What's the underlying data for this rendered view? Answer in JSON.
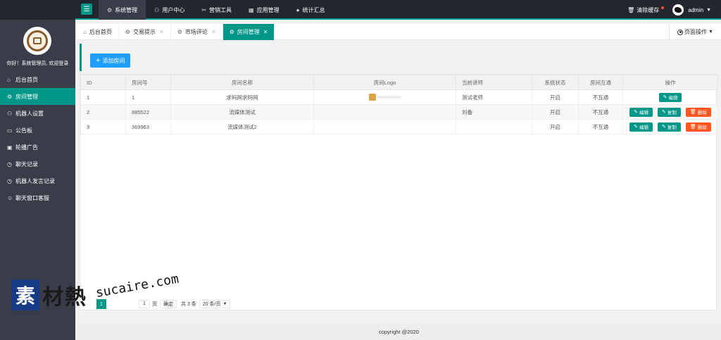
{
  "topbar": {
    "nav": [
      {
        "label": "系统管理",
        "icon": "gear-icon",
        "active": true
      },
      {
        "label": "用户中心",
        "icon": "user-icon",
        "active": false
      },
      {
        "label": "营销工具",
        "icon": "scissors-icon",
        "active": false
      },
      {
        "label": "应用管理",
        "icon": "app-icon",
        "active": false
      },
      {
        "label": "统计汇总",
        "icon": "chat-icon",
        "active": false
      }
    ],
    "clear_cache": "清除缓存",
    "username": "admin"
  },
  "sidebar": {
    "welcome": "你好！系统管理员, 欢迎登录",
    "items": [
      {
        "label": "后台首页",
        "icon": "home-icon",
        "active": false
      },
      {
        "label": "房间管理",
        "icon": "gear-icon",
        "active": true
      },
      {
        "label": "机器人设置",
        "icon": "user-icon",
        "active": false
      },
      {
        "label": "公告板",
        "icon": "board-icon",
        "active": false
      },
      {
        "label": "轮播广告",
        "icon": "image-icon",
        "active": false
      },
      {
        "label": "聊天记录",
        "icon": "clock-icon",
        "active": false
      },
      {
        "label": "机器人发言记录",
        "icon": "clock-icon",
        "active": false
      },
      {
        "label": "聊天窗口客服",
        "icon": "smile-icon",
        "active": false
      }
    ]
  },
  "tabs": [
    {
      "label": "后台首页",
      "closable": false,
      "active": false
    },
    {
      "label": "交易提示",
      "closable": true,
      "active": false
    },
    {
      "label": "市场评论",
      "closable": true,
      "active": false
    },
    {
      "label": "房间管理",
      "closable": true,
      "active": true
    }
  ],
  "page_ops": "页面操作",
  "toolbar": {
    "add_label": "添加房间"
  },
  "table": {
    "headers": [
      "ID",
      "房间号",
      "房间名称",
      "房间Logo",
      "当前讲师",
      "系统状态",
      "房间互通",
      "操作"
    ],
    "rows": [
      {
        "id": "1",
        "room_no": "1",
        "name": "求码网求码网",
        "logo": true,
        "teacher": "测试老师",
        "status": "开启",
        "interop": "不互通",
        "actions": [
          "edit"
        ]
      },
      {
        "id": "2",
        "room_no": "885522",
        "name": "流媒体测试",
        "logo": false,
        "teacher": "刘备",
        "status": "开启",
        "interop": "不互通",
        "actions": [
          "edit",
          "copy",
          "delete"
        ]
      },
      {
        "id": "3",
        "room_no": "369963",
        "name": "流媒体测试2",
        "logo": false,
        "teacher": "",
        "status": "开启",
        "interop": "不互通",
        "actions": [
          "edit",
          "copy",
          "delete"
        ]
      }
    ],
    "action_labels": {
      "edit": "编辑",
      "copy": "复制",
      "delete": "删除"
    }
  },
  "pager": {
    "current": "1",
    "goto_value": "1",
    "page_unit": "页",
    "confirm": "确定",
    "total": "共 3 条",
    "per_page": "20 条/页"
  },
  "footer": "copyright @2020",
  "watermark": {
    "cube": "素",
    "rest": "材熱",
    "url": "sucaire.com"
  },
  "colors": {
    "accent": "#009688",
    "primary": "#1e9fff",
    "danger": "#ff5722",
    "dark": "#23262e",
    "sidebar": "#393d49"
  }
}
